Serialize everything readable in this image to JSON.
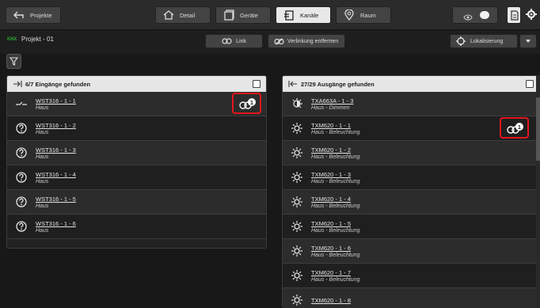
{
  "toolbar": {
    "projekte_label": "Projekte",
    "detail_label": "Detail",
    "geraete_label": "Geräte",
    "kanaele_label": "Kanäle",
    "raum_label": "Raum"
  },
  "project": {
    "logo_text": "KNX",
    "name": "Projekt - 01",
    "link_label": "Link",
    "unlink_label": "Verlinkung entfernen",
    "localization_label": "Lokalisierung"
  },
  "inputs": {
    "header": "6/7 Eingänge gefunden",
    "items": [
      {
        "name": "WST316 - 1 - 1",
        "room": "Haus",
        "icon": "switch-icon",
        "linked": true,
        "link_count": "1"
      },
      {
        "name": "WST316 - 1 - 2",
        "room": "Haus",
        "icon": "question-icon"
      },
      {
        "name": "WST316 - 1 - 3",
        "room": "Haus",
        "icon": "question-icon"
      },
      {
        "name": "WST316 - 1 - 4",
        "room": "Haus",
        "icon": "question-icon"
      },
      {
        "name": "WST316 - 1 - 5",
        "room": "Haus",
        "icon": "question-icon"
      },
      {
        "name": "WST316 - 1 - 6",
        "room": "Haus",
        "icon": "question-icon"
      }
    ]
  },
  "outputs": {
    "header": "27/29 Ausgänge gefunden",
    "items": [
      {
        "name": "TXA663A - 1 - 3",
        "room": "Haus - Dimmen",
        "icon": "dimmer-icon"
      },
      {
        "name": "TXM620 - 1 - 1",
        "room": "Haus - Beleuchtung",
        "icon": "light-icon",
        "linked": true,
        "link_count": "1"
      },
      {
        "name": "TXM620 - 1 - 2",
        "room": "Haus - Beleuchtung",
        "icon": "light-icon"
      },
      {
        "name": "TXM620 - 1 - 3",
        "room": "Haus - Beleuchtung",
        "icon": "light-icon"
      },
      {
        "name": "TXM620 - 1 - 4",
        "room": "Haus - Beleuchtung",
        "icon": "light-icon"
      },
      {
        "name": "TXM620 - 1 - 5",
        "room": "Haus - Beleuchtung",
        "icon": "light-icon"
      },
      {
        "name": "TXM620 - 1 - 6",
        "room": "Haus - Beleuchtung",
        "icon": "light-icon"
      },
      {
        "name": "TXM620 - 1 - 7",
        "room": "Haus - Beleuchtung",
        "icon": "light-icon"
      },
      {
        "name": "TXM620 - 1 - 8",
        "room": "",
        "icon": "light-icon"
      }
    ]
  },
  "colors": {
    "highlight": "#e4161c",
    "knx_green": "#2fa32f",
    "header_bg": "#e6e6e6"
  }
}
